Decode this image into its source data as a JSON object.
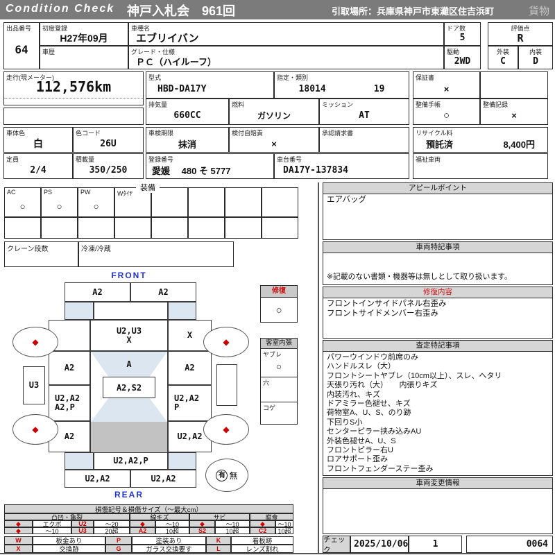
{
  "colors": {
    "header_bar": "#7b7b7b",
    "section_header": "#d6d6d6",
    "glass_blue": "#dce6f1",
    "roof_shade": "#c2c2c2",
    "mark_red": "#cc0000",
    "direction_blue": "#2233cc"
  },
  "header": {
    "logo": "Condition  Check",
    "auction": "神戸入札会　961回",
    "pickup": "引取場所：兵庫県神戸市東灘区住吉浜町",
    "category": "貨物"
  },
  "info": {
    "lot_label": "出品番号",
    "lot": "64",
    "first_reg_label": "初度登録",
    "first_reg": "H27年09月",
    "model_name_label": "車種名",
    "model_name": "エブリイバン",
    "doors_label": "ドア数",
    "doors": "5",
    "history_label": "車歴",
    "history": "",
    "grade_label": "グレード・仕様",
    "grade": "ＰＣ（ハイルーフ）",
    "drive_label": "駆動",
    "drive": "2WD",
    "score_label": "評価点",
    "score": "R",
    "exterior_label": "外装",
    "exterior": "C",
    "interior_label": "内装",
    "interior": "D",
    "odo_label": "走行(現メーター)",
    "odo": "112,576km",
    "model_code_label": "型式",
    "model_code": "HBD-DA17Y",
    "type_label": "指定・類別",
    "type1": "18014",
    "type2": "19",
    "warranty_label": "保証書",
    "warranty": "×",
    "displacement_label": "排気量",
    "displacement": "660CC",
    "fuel_label": "燃料",
    "fuel": "ガソリン",
    "mission_label": "ミッション",
    "mission": "AT",
    "maint_book_label": "整備手帳",
    "maint_book": "○",
    "maint_record_label": "整備記録",
    "maint_record": "×",
    "body_color_label": "車体色",
    "body_color": "白",
    "color_code_label": "色コード",
    "color_code": "26U",
    "inspection_label": "車検期限",
    "inspection": "抹消",
    "insurance_label": "検付自賠責",
    "insurance": "×",
    "approval_label": "承認請求書",
    "approval": "",
    "recycle_label": "リサイクル料",
    "recycle_status": "預託済",
    "recycle_fee": "8,400円",
    "capacity_label": "定員",
    "capacity": "2/4",
    "load_label": "積載量",
    "load": "350/250",
    "reg_no_label": "登録番号",
    "reg_no": "愛媛　 480 そ 5777",
    "chassis_label": "車台番号",
    "chassis": "DA17Y-137834",
    "welfare_label": "福祉車両",
    "welfare": ""
  },
  "equipment": {
    "title": "装備",
    "items": [
      {
        "label": "AC",
        "value": "○"
      },
      {
        "label": "PS",
        "value": "○"
      },
      {
        "label": "PW",
        "value": "○"
      },
      {
        "label": "Wﾀｲﾔ",
        "value": ""
      },
      {
        "label": "",
        "value": ""
      },
      {
        "label": "",
        "value": ""
      },
      {
        "label": "",
        "value": ""
      },
      {
        "label": "",
        "value": ""
      }
    ],
    "crane_label": "クレーン段数",
    "crane": "",
    "fridge_label": "冷凍/冷蔵",
    "fridge": ""
  },
  "repair_flag": {
    "title": "修復",
    "mark": "○"
  },
  "cabin_lining": {
    "title": "客室内張",
    "rows": [
      {
        "label": "ヤブレ",
        "mark": "○"
      },
      {
        "label": "穴",
        "mark": ""
      },
      {
        "label": "コゲ",
        "mark": ""
      }
    ]
  },
  "diagram": {
    "front_label": "FRONT",
    "rear_label": "REAR",
    "bumper_front_left": "A2",
    "bumper_front_right": "A2",
    "cowl_line1": "U2,U3",
    "cowl_line2": "X",
    "fender_front_right": "X",
    "door_front_left": "A2",
    "windshield": "A",
    "door_front_right": "A2",
    "rocker_left": "U3",
    "roof": "A2,S2",
    "slide_left_line1": "U2,A2",
    "slide_left_line2": "A2,P",
    "slide_right_line1": "U2,A2",
    "slide_right_line2": "P",
    "quarter_left": "A2",
    "quarter_right": "U2,A2",
    "back_door_upper": "U2,A2,P",
    "bumper_rear_left": "U2,A2",
    "bumper_rear_right": "U2,A2",
    "wheel_mark": "◆",
    "spare_yes": "有",
    "spare_no": "無"
  },
  "right": {
    "appeal": {
      "title": "アピールポイント",
      "lines": [
        "エアバッグ"
      ]
    },
    "notes": {
      "title": "車両特記事項",
      "footnote": "※記載のない書類・機器等は無しとして取り扱います。"
    },
    "repair": {
      "title": "修復内容",
      "lines": [
        "フロントインサイドパネル右歪み",
        "フロントサイドメンバー右歪み"
      ]
    },
    "assessment": {
      "title": "査定特記事項",
      "lines": [
        "パワーウインドウ前席のみ",
        "ハンドルスレ（大）",
        "フロントシートヤブレ（10cm以上）、スレ、ヘタリ",
        "天張り汚れ（大）　　内張りキズ",
        "内装汚れ、キズ",
        "ドアミラー色褪せ、キズ",
        "荷物室A、U、S、のり跡",
        "下回りS小",
        "センターピラー挟み込みAU",
        "外装色褪せA、U、S",
        "フロントピラー右U",
        "ロアサポート歪み",
        "フロントフェンダーステー歪み"
      ]
    },
    "changes": {
      "title": "車両変更情報"
    },
    "check": {
      "label": "チェック",
      "date": "2025/10/06",
      "value": "1",
      "serial": "0064"
    }
  },
  "legend": {
    "title": "損傷記号＆損傷サイズ（～最大cm）",
    "groups": [
      "凸凹・亀裂",
      "線キズ",
      "サビ",
      "腐食"
    ],
    "row1": [
      "◆",
      "エクボ",
      "U2",
      "～20",
      "◆",
      "～10",
      "◆",
      "～10",
      "◆",
      "～10"
    ],
    "row2": [
      "◆",
      "～10",
      "U3",
      "20超",
      "A2",
      "10超",
      "S2",
      "10超",
      "C2",
      "10超"
    ],
    "keys": [
      [
        "W",
        "板金あり"
      ],
      [
        "X",
        "交換跡"
      ],
      [
        "P",
        "塗装あり"
      ],
      [
        "G",
        "ガラス交換要す"
      ],
      [
        "K",
        "看板跡"
      ],
      [
        "L",
        "レンズ割れ"
      ]
    ]
  }
}
